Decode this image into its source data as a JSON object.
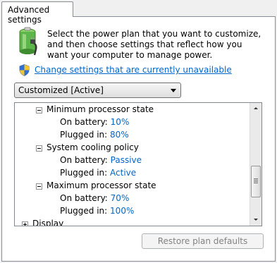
{
  "tab": {
    "label": "Advanced settings"
  },
  "description": "Select the power plan that you want to customize, and then choose settings that reflect how you want your computer to manage power.",
  "change_link": "Change settings that are currently unavailable",
  "plan_select": {
    "selected": "Customized [Active]"
  },
  "tree": {
    "min_processor": {
      "label": "Minimum processor state",
      "battery_label": "On battery:",
      "battery_value": "10%",
      "plugged_label": "Plugged in:",
      "plugged_value": "80%"
    },
    "cooling": {
      "label": "System cooling policy",
      "battery_label": "On battery:",
      "battery_value": "Passive",
      "plugged_label": "Plugged in:",
      "plugged_value": "Active"
    },
    "max_processor": {
      "label": "Maximum processor state",
      "battery_label": "On battery:",
      "battery_value": "70%",
      "plugged_label": "Plugged in:",
      "plugged_value": "100%"
    },
    "display": {
      "label": "Display"
    }
  },
  "restore_button": "Restore plan defaults",
  "colors": {
    "link": "#0066cc",
    "disabled_text": "#838383",
    "border": "#898c95"
  }
}
